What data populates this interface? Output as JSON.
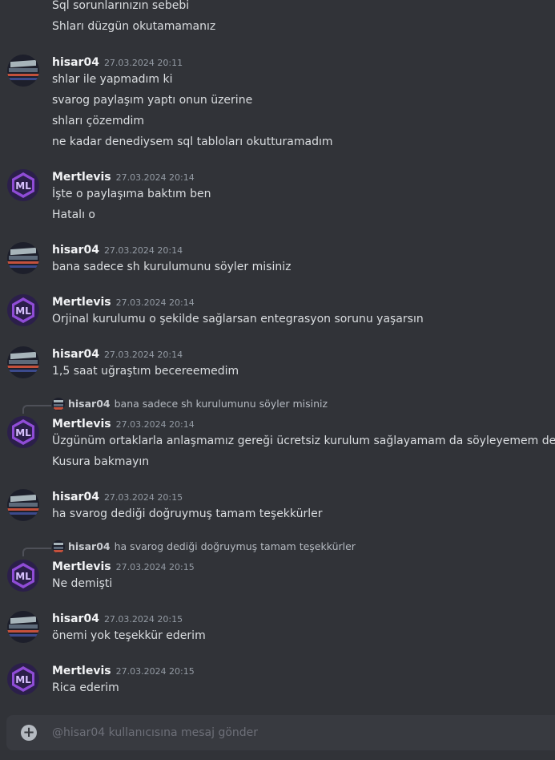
{
  "channel": {
    "continuation": [
      "Sql sorunlarınızın sebebi",
      "Shları düzgün okutamamanız"
    ],
    "messages": [
      {
        "user": "hisar04",
        "time": "27.03.2024 20:11",
        "lines": [
          "shlar ile yapmadım ki",
          "svarog paylaşım yaptı onun üzerine",
          "shları çözemdim",
          "ne kadar denediysem sql tabloları okutturamadım"
        ]
      },
      {
        "user": "Mertlevis",
        "time": "27.03.2024 20:14",
        "lines": [
          "İşte o paylaşıma baktım ben",
          "Hatalı o"
        ]
      },
      {
        "user": "hisar04",
        "time": "27.03.2024 20:14",
        "lines": [
          "bana sadece sh kurulumunu söyler misiniz"
        ]
      },
      {
        "user": "Mertlevis",
        "time": "27.03.2024 20:14",
        "lines": [
          "Orjinal kurulumu o şekilde sağlarsan entegrasyon sorunu yaşarsın"
        ]
      },
      {
        "user": "hisar04",
        "time": "27.03.2024 20:14",
        "lines": [
          "1,5 saat uğraştım becereemedim"
        ]
      },
      {
        "user": "Mertlevis",
        "time": "27.03.2024 20:14",
        "reply": {
          "user": "hisar04",
          "text": "bana sadece sh kurulumunu söyler misiniz"
        },
        "lines": [
          "Üzgünüm ortaklarla anlaşmamız gereği ücretsiz kurulum sağlayamam da söyleyemem de",
          "Kusura bakmayın"
        ]
      },
      {
        "user": "hisar04",
        "time": "27.03.2024 20:15",
        "lines": [
          "ha svarog dediği doğruymuş tamam teşekkürler"
        ]
      },
      {
        "user": "Mertlevis",
        "time": "27.03.2024 20:15",
        "reply": {
          "user": "hisar04",
          "text": "ha svarog dediği doğruymuş tamam teşekkürler"
        },
        "lines": [
          "Ne demişti"
        ]
      },
      {
        "user": "hisar04",
        "time": "27.03.2024 20:15",
        "lines": [
          "önemi yok teşekkür ederim"
        ]
      },
      {
        "user": "Mertlevis",
        "time": "27.03.2024 20:15",
        "lines": [
          "Rica ederim"
        ]
      }
    ]
  },
  "composer": {
    "placeholder": "@hisar04 kullanıcısına mesaj gönder",
    "add_icon": "plus-circle-icon"
  },
  "avatars": {
    "hisar04": "landscape-avatar",
    "Mertlevis": "ml-logo-avatar"
  },
  "colors": {
    "background": "#313338",
    "composer": "#383a40",
    "username": "#f2f3f5",
    "timestamp": "#949ba4",
    "text": "#dbdee1"
  }
}
